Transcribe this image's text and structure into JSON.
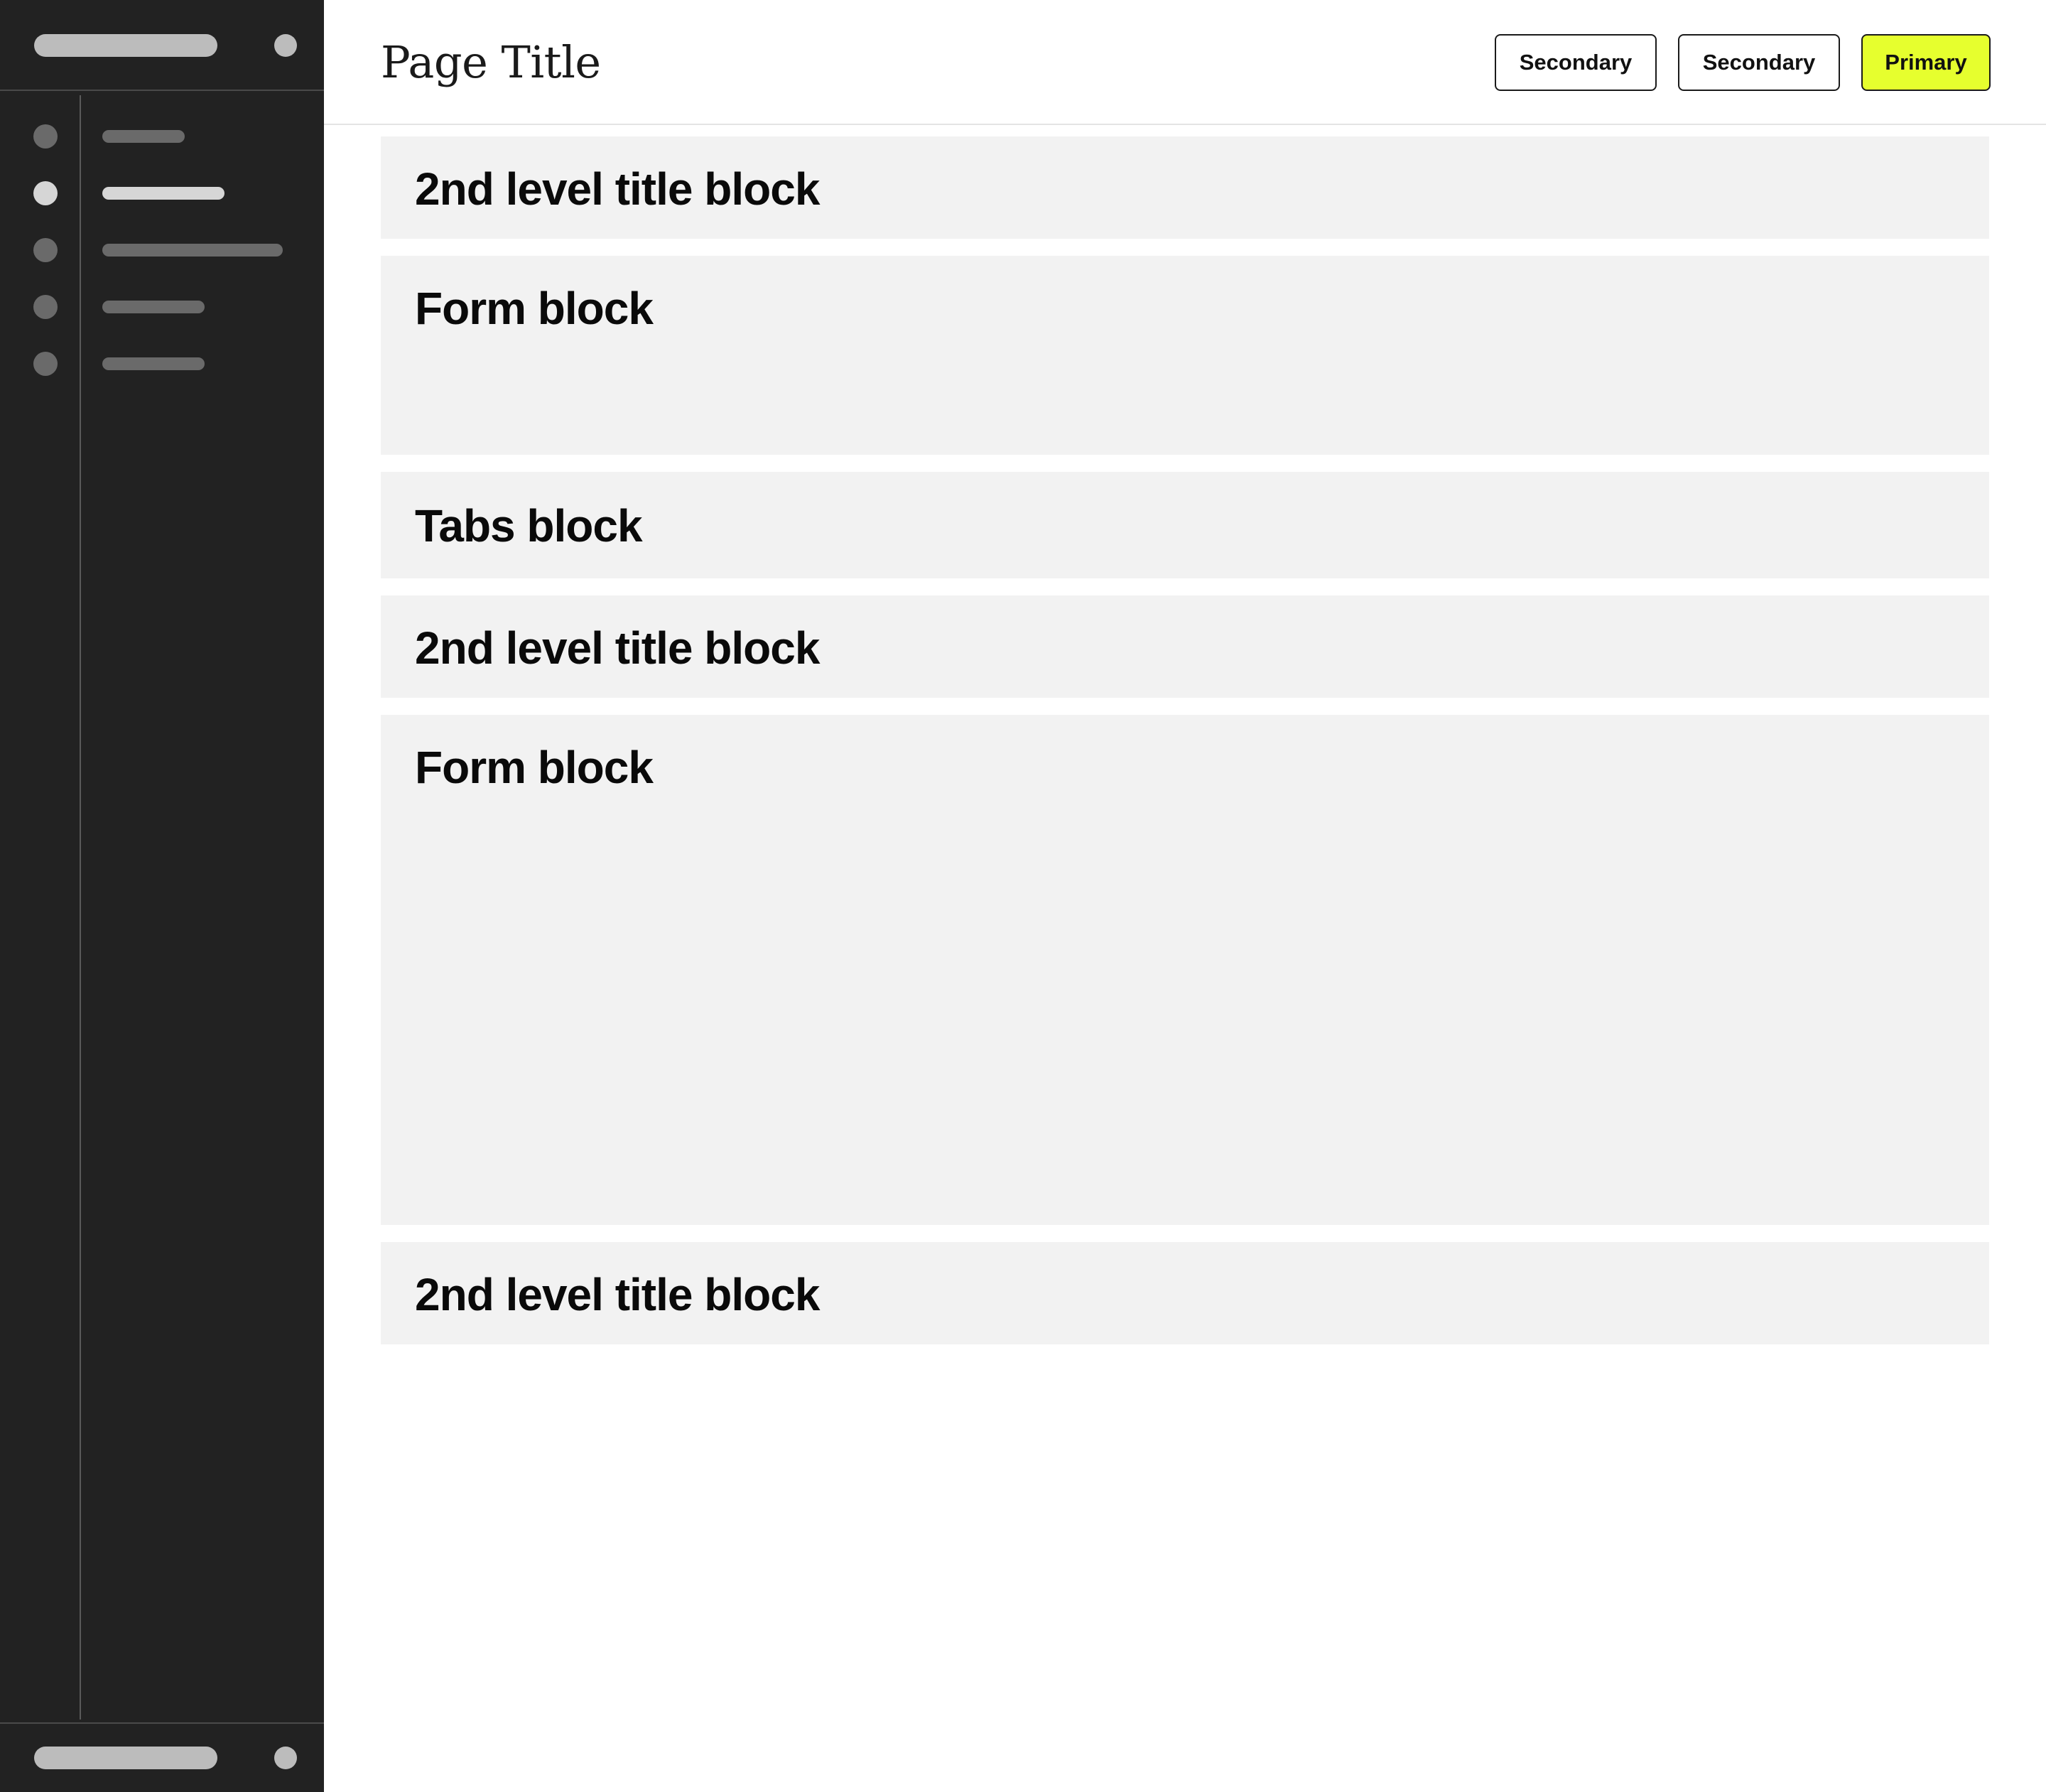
{
  "header": {
    "page_title": "Page Title",
    "buttons": {
      "secondary_1": "Secondary",
      "secondary_2": "Secondary",
      "primary": "Primary"
    }
  },
  "blocks": [
    {
      "title": "2nd level title block"
    },
    {
      "title": "Form block"
    },
    {
      "title": "Tabs block"
    },
    {
      "title": "2nd level title block"
    },
    {
      "title": "Form block"
    },
    {
      "title": "2nd level title block"
    }
  ],
  "colors": {
    "sidebar_bg": "#222222",
    "primary_accent": "#e6ff2e",
    "block_bg": "#f2f2f2"
  },
  "sidebar": {
    "active_item_index": 1
  }
}
